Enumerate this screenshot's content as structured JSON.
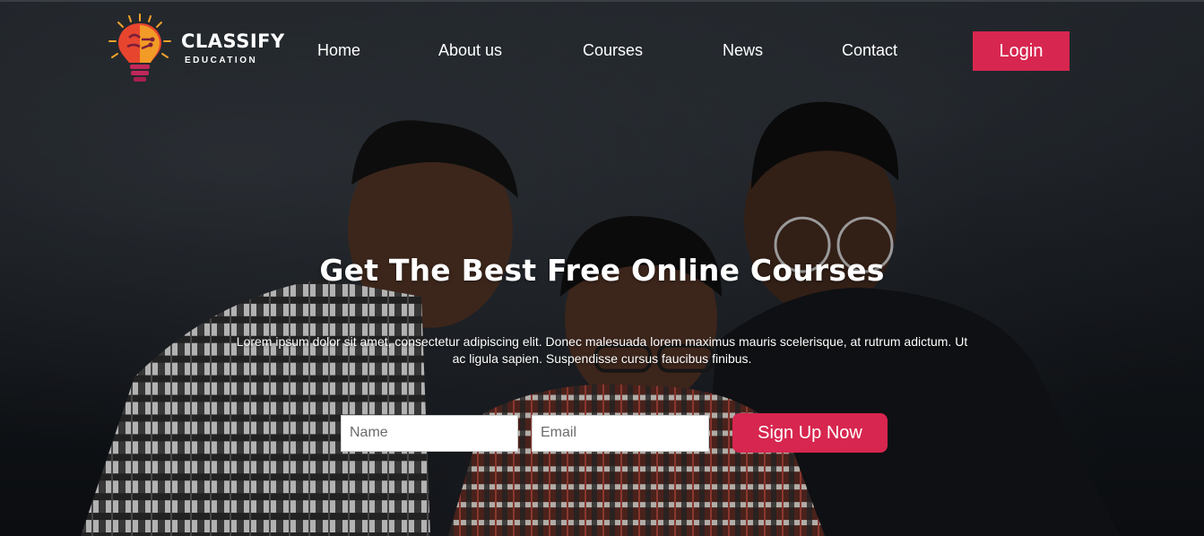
{
  "brand": {
    "name": "CLASSIFY",
    "tagline": "EDUCATION"
  },
  "nav": {
    "items": [
      {
        "label": "Home"
      },
      {
        "label": "About us"
      },
      {
        "label": "Courses"
      },
      {
        "label": "News"
      },
      {
        "label": "Contact"
      }
    ],
    "login_label": "Login"
  },
  "hero": {
    "headline": "Get The Best Free Online Courses",
    "lead": "Lorem ipsum dolor sit amet, consectetur adipiscing elit. Donec malesuada lorem maximus mauris scelerisque, at rutrum adictum. Ut ac ligula sapien. Suspendisse cursus faucibus finibus.",
    "form": {
      "name_placeholder": "Name",
      "email_placeholder": "Email",
      "signup_label": "Sign Up Now"
    }
  },
  "colors": {
    "accent": "#d7264f",
    "text": "#ffffff",
    "background": "#171b20"
  },
  "icons": {
    "logo": "lightbulb-brain-icon"
  }
}
